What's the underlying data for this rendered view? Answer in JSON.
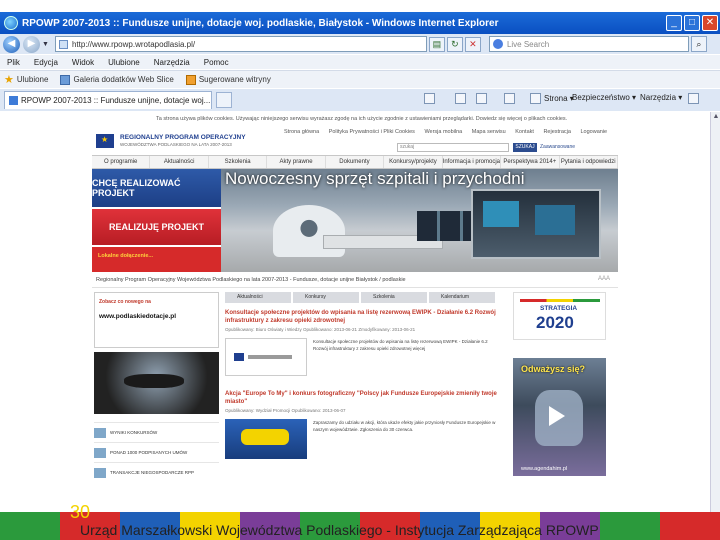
{
  "window": {
    "title": "RPOWP 2007-2013 :: Fundusze unijne, dotacje woj. podlaskie, Białystok - Windows Internet Explorer",
    "controls": {
      "minimize": "_",
      "maximize": "□",
      "close": "✕"
    }
  },
  "address": {
    "url": "http://www.rpowp.wrotapodlasia.pl/",
    "search_placeholder": "Live Search"
  },
  "menu": [
    "Plik",
    "Edycja",
    "Widok",
    "Ulubione",
    "Narzędzia",
    "Pomoc"
  ],
  "favorites": {
    "label": "Ulubione",
    "items": [
      "Galeria dodatków Web Slice",
      "Sugerowane witryny"
    ]
  },
  "tab": {
    "label": "RPOWP 2007-2013 :: Fundusze unijne, dotacje woj..."
  },
  "commands": [
    "Strona",
    "Bezpieczeństwo",
    "Narzędzia"
  ],
  "site": {
    "top_strip": "Ta strona używa plików cookies. Używając niniejszego serwisu wyrażasz zgodę na ich użycie zgodnie z ustawieniami przeglądarki. Dowiedz się więcej o plikach cookies.",
    "logo_title": "REGIONALNY PROGRAM OPERACYJNY",
    "logo_sub": "WOJEWÓDZTWA PODLASKIEGO NA LATA 2007-2013",
    "toplinks": [
      "Strona główna",
      "Polityka Prywatności i Pliki Cookies",
      "Wersja mobilna",
      "Mapa serwisu",
      "Kontakt",
      "Rejestracja",
      "Logowanie"
    ],
    "search_label": "szukaj",
    "search_button": "SZUKAJ",
    "advanced": "Zaawansowane",
    "nav": [
      "O programie",
      "Aktualności",
      "Szkolenia",
      "Akty prawne",
      "Dokumenty",
      "Konkursy/projekty",
      "Informacja i promocja",
      "Perspektywa 2014+",
      "Pytania i odpowiedzi"
    ],
    "hero_caption": "Nowoczesny sprzęt szpitali i przychodni",
    "btn_chce": "CHCĘ REALIZOWAĆ PROJEKT",
    "btn_realizuje": "REALIZUJĘ PROJEKT",
    "btn_dolacz": "Lokalne dołączenie...",
    "breadcrumb": "Regionalny Program Operacyjny Województwa Podlaskiego na lata 2007-2013 - Fundusze, dotacje unijne Białystok / podlaskie",
    "font_size": "AAA",
    "left_banner_top": "Zobacz co nowego na",
    "left_banner_url": "www.podlaskiedotacje.pl",
    "left_links": [
      "WYNIKI KONKURSÓW",
      "PONAD 1000 PODPISANYCH UMÓW",
      "TRANSAKCJE NIEGOSPODARCZE RPP"
    ],
    "tabs": [
      "Aktualności",
      "Konkursy",
      "Szkolenia",
      "Kalendarium"
    ],
    "news": [
      {
        "title": "Konsultacje społeczne projektów do wpisania na listę rezerwową EWIPK - Działanie 6.2 Rozwój infrastruktury z zakresu opieki zdrowotnej",
        "meta": "Opublikowany: Biuro Oświaty i Wiedzy  Opublikowano: 2013-06-21  Zmodyfikowany: 2013-06-21",
        "body": "Konsultacje społeczne projektów do wpisania na listę rezerwową EWIPK - Działanie 6.2 Rozwój infrastruktury z zakresu opieki zdrowotnej więcej"
      },
      {
        "title": "Akcja \"Europe To My\" i konkurs fotograficzny \"Polscy jak Fundusze Europejskie zmieniły twoje miasto\"",
        "meta": "Opublikowany: Wydział Promocji  Opublikowano: 2013-06-07",
        "body": "Zapraszamy do udziału w akcji, która ukaże efekty jakie przyniosły Fundusze Europejskie w naszym województwie. Zgłoszenia do 30 czerwca."
      }
    ],
    "strategia_label": "STRATEGIA",
    "strategia_year": "2020",
    "odwaz_label": "Odważysz się?",
    "odwaz_url": "www.agendahim.pl"
  },
  "slide": {
    "page_number": "30",
    "footer_text": "Urząd Marszałkowski Województwa Podlaskiego - Instytucja Zarządzająca RPOWP",
    "colors": {
      "stripe": [
        "#2b9a3c",
        "#d62a2a",
        "#1f5fb8",
        "#f3d300",
        "#7a3d98",
        "#2b9a3c",
        "#d62a2a",
        "#1f5fb8",
        "#f3d300",
        "#7a3d98",
        "#2b9a3c",
        "#d62a2a"
      ]
    }
  }
}
